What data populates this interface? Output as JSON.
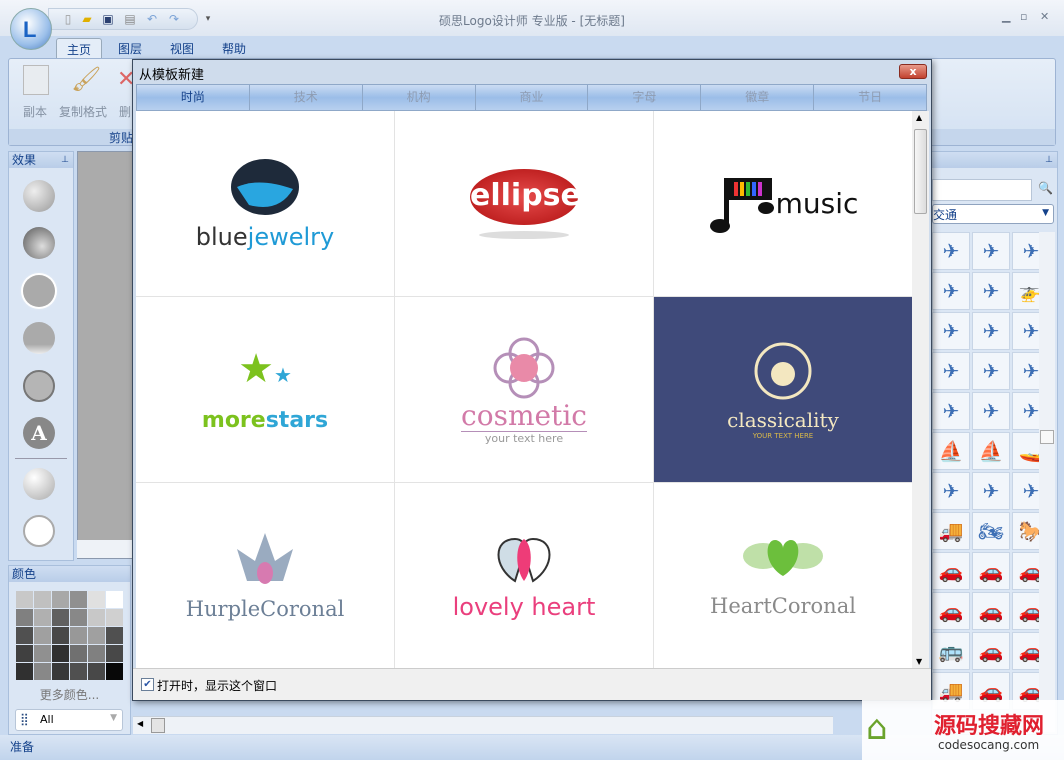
{
  "app": {
    "title": "硕思Logo设计师 专业版 - [无标题]",
    "orb_letter": "L"
  },
  "quick_access": [
    "new-icon",
    "open-icon",
    "save-icon",
    "print-icon",
    "undo-icon",
    "redo-icon"
  ],
  "ribbon": {
    "tabs": [
      "主页",
      "图层",
      "视图",
      "帮助"
    ],
    "buttons": [
      "副本",
      "复制格式",
      "删"
    ],
    "group_label": "剪贴"
  },
  "left_panel": {
    "title": "效果"
  },
  "color_panel": {
    "title": "颜色",
    "swatches": [
      "#c8c8c8",
      "#c0c0c0",
      "#a8a8a8",
      "#909090",
      "#e0e0e0",
      "#ffffff",
      "#808080",
      "#b0b0b0",
      "#606060",
      "#888888",
      "#c8c8c8",
      "#d0d0d0",
      "#505050",
      "#a0a0a0",
      "#484848",
      "#989898",
      "#a0a0a0",
      "#505050",
      "#404040",
      "#909090",
      "#303030",
      "#707070",
      "#808080",
      "#484848",
      "#303030",
      "#888888",
      "#383838",
      "#505050",
      "#484848",
      "#080808"
    ],
    "more_colors": "更多颜色...",
    "filter": "All"
  },
  "right_panel": {
    "category": "交通",
    "icons": [
      "✈",
      "✈",
      "✈",
      "✈",
      "✈",
      "🚁",
      "✈",
      "✈",
      "✈",
      "✈",
      "✈",
      "✈",
      "✈",
      "✈",
      "✈",
      "⛵",
      "⛵",
      "🚤",
      "✈",
      "✈",
      "✈",
      "🚚",
      "🏍",
      "🐎",
      "🚗",
      "🚗",
      "🚗",
      "🚗",
      "🚗",
      "🚗",
      "🚌",
      "🚗",
      "🚗",
      "🚚",
      "🚗",
      "🚗"
    ]
  },
  "status": {
    "text": "准备"
  },
  "dialog": {
    "title": "从模板新建",
    "close": "x",
    "tabs": [
      "时尚",
      "技术",
      "机构",
      "商业",
      "字母",
      "徽章",
      "节日"
    ],
    "active_tab": 0,
    "templates": [
      {
        "a": "blue",
        "b": "jewelry"
      },
      {
        "a": "ellipse"
      },
      {
        "a": "music"
      },
      {
        "a": "more",
        "b": "stars"
      },
      {
        "a": "cosmetic",
        "b": "your text here"
      },
      {
        "a": "classicality",
        "b": "YOUR TEXT HERE"
      },
      {
        "a": "HurpleCoronal"
      },
      {
        "a": "lovely heart"
      },
      {
        "a": "HeartCoronal"
      }
    ],
    "show_on_open": "打开时，显示这个窗口",
    "checked": true
  },
  "watermark": {
    "cn": "源码搜藏网",
    "url": "codesocang.com"
  }
}
